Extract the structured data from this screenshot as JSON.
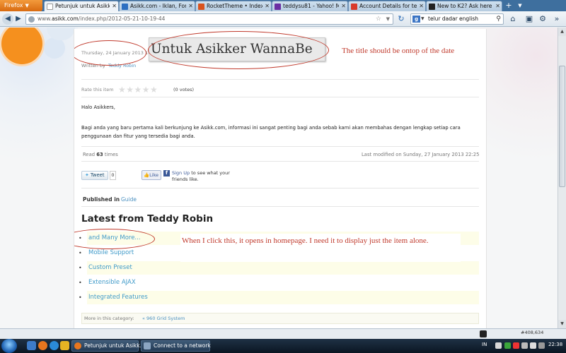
{
  "browser": {
    "menu_button": "Firefox",
    "tabs": [
      {
        "label": "Petunjuk untuk Asikker",
        "active": true,
        "icon": "page-icon"
      },
      {
        "label": "Asikk.com - Iklan, Foru...",
        "active": false,
        "icon": "asikk-icon"
      },
      {
        "label": "RocketTheme • Index ...",
        "active": false,
        "icon": "rockettheme-icon"
      },
      {
        "label": "teddysu81 - Yahoo! Mail",
        "active": false,
        "icon": "yahoo-icon"
      },
      {
        "label": "Account Details for ted...",
        "active": false,
        "icon": "gmail-icon"
      },
      {
        "label": "New to K2? Ask here fir...",
        "active": false,
        "icon": "k2-icon"
      }
    ],
    "new_tab": "+",
    "url_domain": "asikk.com",
    "url_prefix": "www.",
    "url_path": "/index.php/2012-05-21-10-19-44",
    "search_engine": "g",
    "search_text": "telur dadar english"
  },
  "article": {
    "date": "Thursday, 24 January 2013 14:23",
    "title": "Untuk Asikker WannaBe",
    "written_by_label": "Written by",
    "author": "Teddy Robin",
    "rate_label": "Rate this item",
    "votes": "(0 votes)",
    "greeting": "Halo Asikkers,",
    "intro": "Bagi anda yang baru pertama kali berkunjung ke Asikk.com, informasi ini sangat penting bagi anda sebab kami akan membahas dengan lengkap setiap cara penggunaan dan fitur yang tersedia bagi anda.",
    "read_prefix": "Read",
    "read_count": "63",
    "read_suffix": "times",
    "modified": "Last modified on Sunday, 27 January 2013 22:25",
    "tweet_label": "Tweet",
    "tweet_count": "0",
    "like_label": "Like",
    "fb_signup": "Sign Up",
    "fb_text": "to see what your friends like.",
    "published_label": "Published in",
    "published_category": "Guide",
    "latest_heading": "Latest from Teddy Robin",
    "latest_items": [
      "and Many More...",
      "Mobile Support",
      "Custom Preset",
      "Extensible AJAX",
      "Integrated Features"
    ],
    "more_label": "More in this category:",
    "more_link": "« 960 Grid System"
  },
  "annotations": {
    "note_title": "The title should be ontop of the date",
    "note_link": "When I click this, it opens in homepage. I need it to display just the item alone."
  },
  "statusbar": {
    "coords": "#408,634"
  },
  "taskbar": {
    "tasks": [
      "Petunjuk untuk Asikk...",
      "Connect to a network"
    ],
    "lang": "IN",
    "clock": "22:38"
  },
  "colors": {
    "annotation_red": "#c0392b",
    "link_blue": "#3f9ac9",
    "deco_orange": "#f5901e",
    "deco_red": "#e8163a"
  }
}
